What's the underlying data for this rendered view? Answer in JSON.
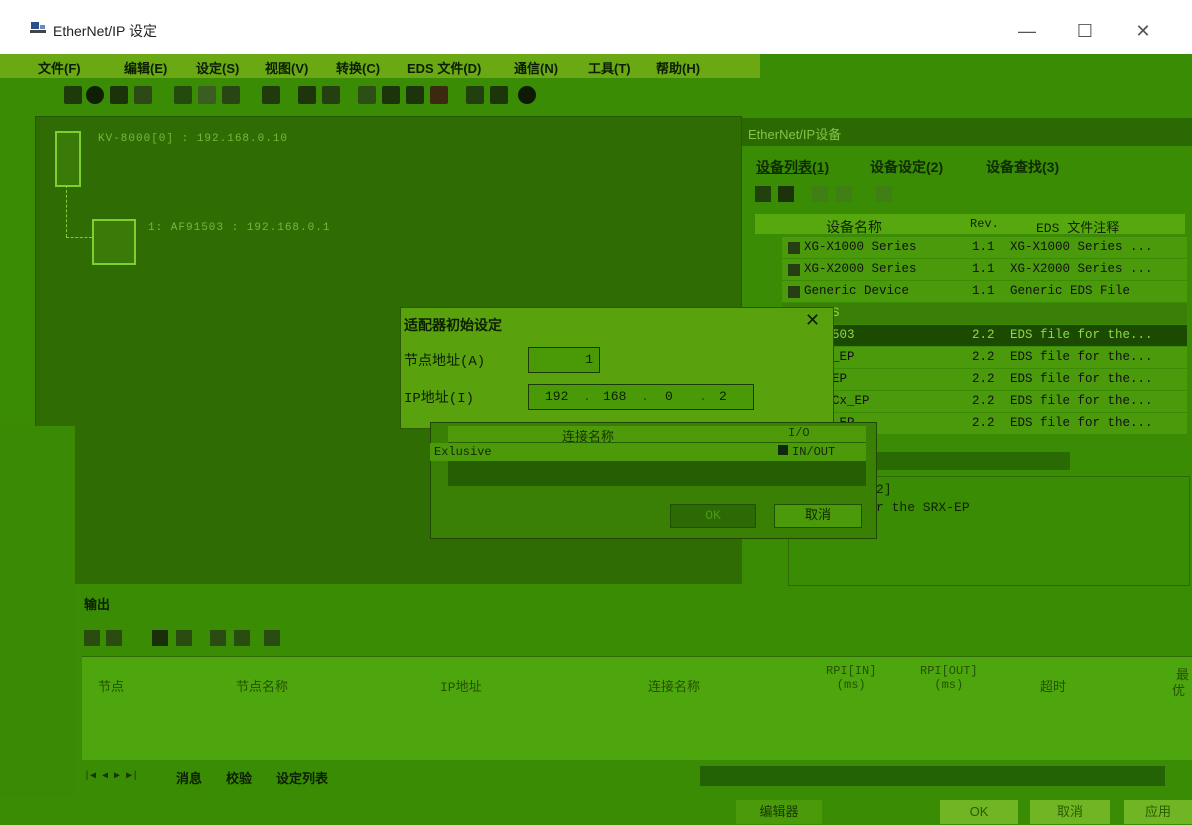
{
  "window": {
    "title": "EtherNet/IP 设定",
    "minimize": "—",
    "maximize": "☐",
    "close": "✕"
  },
  "menu": {
    "items": [
      "文件(F)",
      "编辑(E)",
      "设定(S)",
      "视图(V)",
      "转换(C)",
      "EDS 文件(D)",
      "通信(N)",
      "工具(T)",
      "帮助(H)"
    ]
  },
  "canvas": {
    "node0_label": "KV-8000[0] : 192.168.0.10",
    "node1_label": "1: AF91503 : 192.168.0.1"
  },
  "right_panel": {
    "title": "EtherNet/IP设备",
    "tabs": [
      "设备列表(1)",
      "设备设定(2)",
      "设备查找(3)"
    ],
    "columns": [
      "设备名称",
      "Rev.",
      "EDS 文件注释"
    ],
    "rows": [
      {
        "name": "XG-X1000 Series",
        "rev": "1.1",
        "comment": "XG-X1000 Series ..."
      },
      {
        "name": "XG-X2000 Series",
        "rev": "1.1",
        "comment": "XG-X2000 Series ..."
      },
      {
        "name": "Generic Device",
        "rev": "1.1",
        "comment": "Generic EDS File"
      },
      {
        "name": "S",
        "rev": "",
        "comment": ""
      },
      {
        "name": "503",
        "rev": "2.2",
        "comment": "EDS file for the..."
      },
      {
        "name": "_EP",
        "rev": "2.2",
        "comment": "EDS file for the..."
      },
      {
        "name": "EP",
        "rev": "2.2",
        "comment": "EDS file for the..."
      },
      {
        "name": "Cx_EP",
        "rev": "2.2",
        "comment": "EDS file for the..."
      },
      {
        "name": "_EP",
        "rev": "2.2",
        "comment": "EDS file for the..."
      }
    ],
    "info_line1": "2]",
    "info_line2": "r the SRX-EP"
  },
  "dialog": {
    "title": "适配器初始设定",
    "close": "✕",
    "node_label": "节点地址(A)",
    "node_value": "1",
    "ip_label": "IP地址(I)",
    "ip_octets": [
      "192",
      "168",
      "0",
      "2"
    ],
    "ip_dot": "."
  },
  "connection": {
    "col_name": "连接名称",
    "col_io": "I/O",
    "row_name": "Exlusive",
    "row_io": "IN/OUT",
    "ok": "OK",
    "cancel": "取消"
  },
  "output": {
    "title": "输出",
    "columns": [
      "节点",
      "节点名称",
      "IP地址",
      "连接名称",
      "RPI[IN]\n(ms)",
      "RPI[OUT]\n(ms)",
      "超时"
    ],
    "col_extra_top": "最",
    "col_extra_bottom": "优",
    "sheet_tabs": [
      "消息",
      "校验",
      "设定列表"
    ],
    "nav": "|◀ ◀ ▶ ▶|"
  },
  "statusbar": {
    "editor": "编辑器",
    "ok": "OK",
    "cancel": "取消",
    "apply": "应用"
  }
}
